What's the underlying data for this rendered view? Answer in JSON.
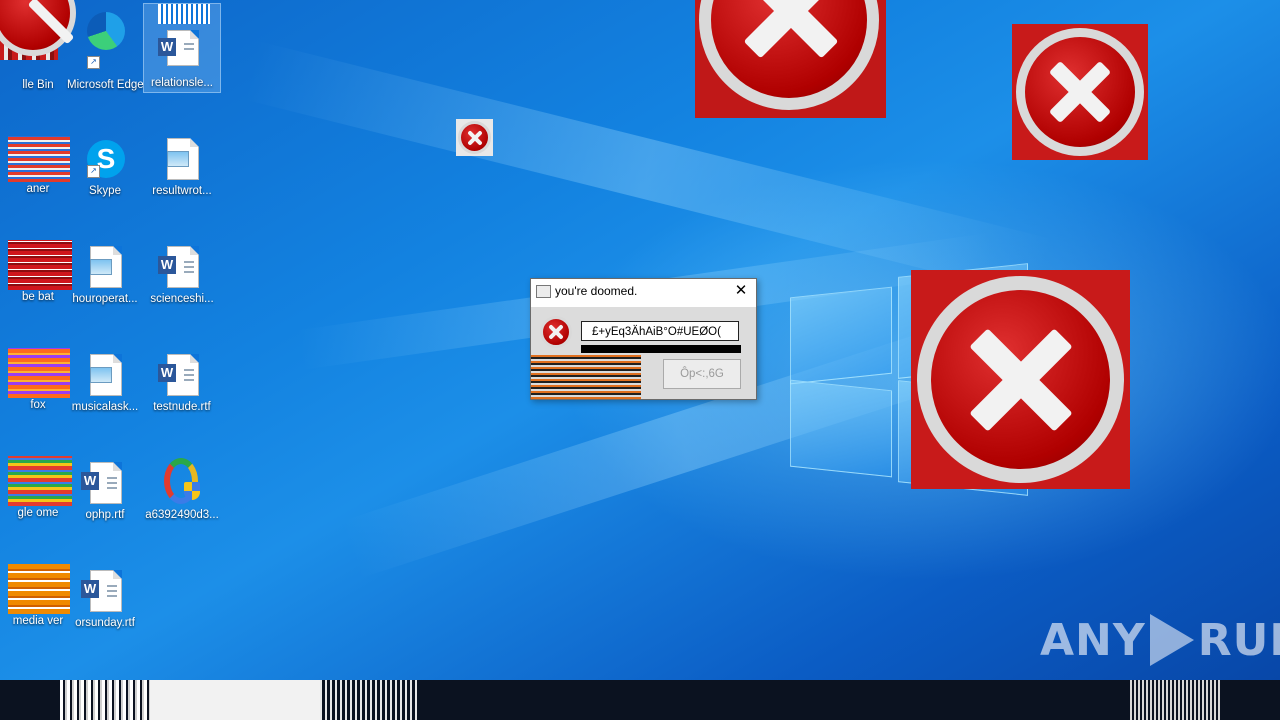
{
  "desktop": {
    "icons": [
      {
        "label": "lle Bin"
      },
      {
        "label": "Microsoft Edge"
      },
      {
        "label": "relationsle..."
      },
      {
        "label": "aner"
      },
      {
        "label": "Skype"
      },
      {
        "label": "resultwrot..."
      },
      {
        "label": "be bat"
      },
      {
        "label": "houroperat..."
      },
      {
        "label": "scienceshi..."
      },
      {
        "label": "fox"
      },
      {
        "label": "musicalask..."
      },
      {
        "label": "testnude.rtf"
      },
      {
        "label": "gle ome"
      },
      {
        "label": "ophp.rtf"
      },
      {
        "label": "a6392490d3..."
      },
      {
        "label": "media ver"
      },
      {
        "label": "orsunday.rtf"
      }
    ]
  },
  "dialog": {
    "title": "you're doomed.",
    "close_symbol": "✕",
    "message": "£+yEq3ÄhAiB°O#UEØO(",
    "button_label": "Ôp<:,6G"
  },
  "watermark": {
    "left": "ANY",
    "right": "RUN"
  },
  "colors": {
    "desktop_blue": "#0a6fd8",
    "error_red": "#c00000",
    "taskbar": "#0b1220"
  }
}
